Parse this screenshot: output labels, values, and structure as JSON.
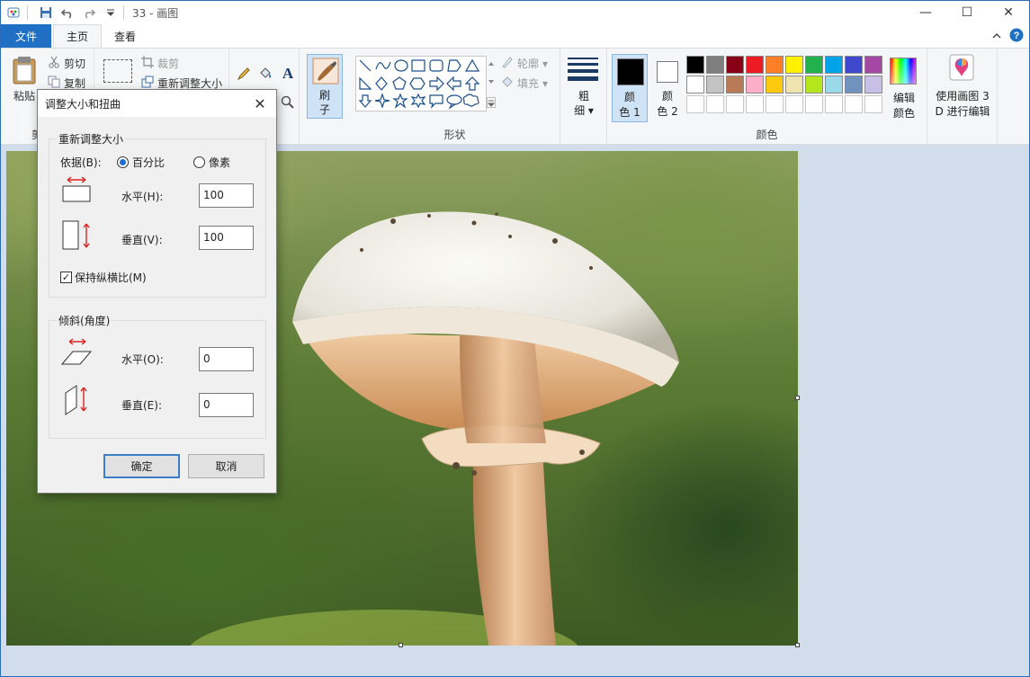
{
  "titlebar": {
    "title": "33 - 画图",
    "icons": [
      "paint-app-icon",
      "save-icon",
      "undo-icon",
      "redo-icon",
      "customize-dropdown-icon"
    ]
  },
  "window_controls": {
    "minimize": "—",
    "maximize": "☐",
    "close": "✕"
  },
  "tabs": [
    {
      "label": "文件"
    },
    {
      "label": "主页"
    },
    {
      "label": "查看"
    }
  ],
  "clipboard": {
    "paste": "粘贴",
    "cut": "剪切",
    "copy": "复制",
    "group_partial": "剪"
  },
  "image_group": {
    "crop": "裁剪",
    "resize": "重新调整大小"
  },
  "brushes": {
    "label_line1": "刷",
    "label_line2": "子"
  },
  "shapes": {
    "outline": "轮廓",
    "fill": "填充",
    "group_label": "形状"
  },
  "size": {
    "label_line1": "粗",
    "label_line2": "细"
  },
  "colors": {
    "color1_line1": "颜",
    "color1_line2": "色 1",
    "color2_line1": "颜",
    "color2_line2": "色 2",
    "edit_line1": "编辑",
    "edit_line2": "颜色",
    "group_label": "颜色",
    "palette": [
      "#000000",
      "#7f7f7f",
      "#880015",
      "#ed1c24",
      "#ff7f27",
      "#fff200",
      "#22b14c",
      "#00a2e8",
      "#3f48cc",
      "#a349a4",
      "#ffffff",
      "#c3c3c3",
      "#b97a57",
      "#ffaec9",
      "#ffc90e",
      "#efe4b0",
      "#b5e61d",
      "#99d9ea",
      "#7092be",
      "#c8bfe7",
      "#ffffff",
      "#ffffff",
      "#ffffff",
      "#ffffff",
      "#ffffff",
      "#ffffff",
      "#ffffff",
      "#ffffff",
      "#ffffff",
      "#ffffff"
    ],
    "color1": "#000000",
    "color2": "#ffffff"
  },
  "paint3d": {
    "line1": "使用画图 3",
    "line2": "D 进行编辑"
  },
  "dialog": {
    "title": "调整大小和扭曲",
    "resize": {
      "legend": "重新调整大小",
      "by_label": "依据(B):",
      "percent_label": "百分比",
      "pixels_label": "像素",
      "selected": "百分比",
      "horizontal_label": "水平(H):",
      "horizontal_value": "100",
      "vertical_label": "垂直(V):",
      "vertical_value": "100",
      "keep_ratio_label": "保持纵横比(M)",
      "keep_ratio_checked": true
    },
    "skew": {
      "legend": "倾斜(角度)",
      "horizontal_label": "水平(O):",
      "horizontal_value": "0",
      "vertical_label": "垂直(E):",
      "vertical_value": "0"
    },
    "ok": "确定",
    "cancel": "取消"
  }
}
